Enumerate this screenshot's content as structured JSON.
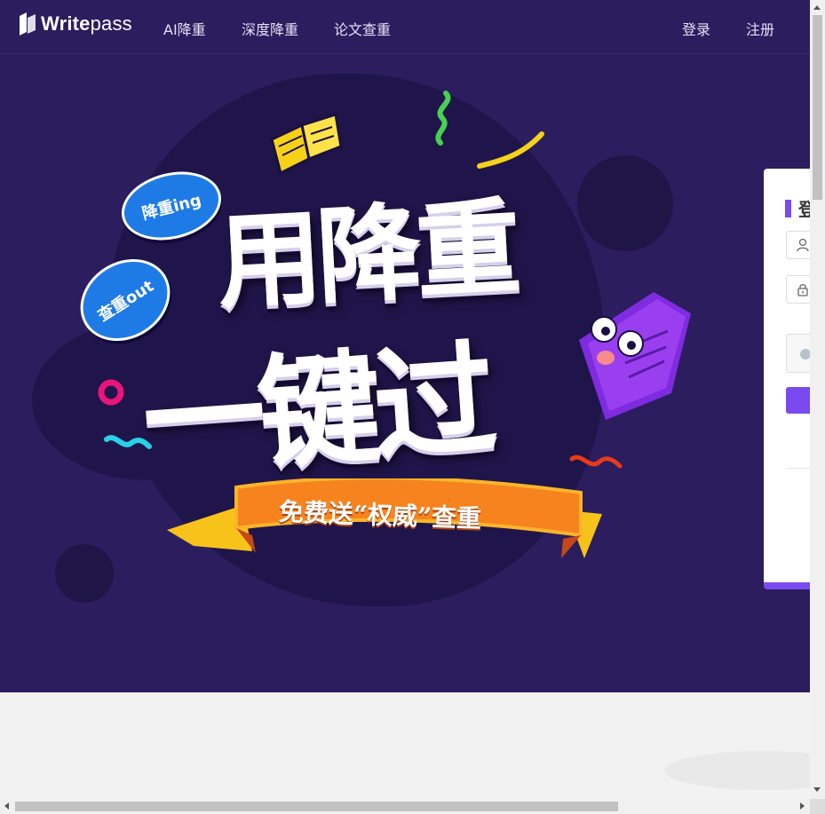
{
  "brand": {
    "name_bold": "Write",
    "name_light": "pass"
  },
  "nav": {
    "items": [
      {
        "label": "AI降重"
      },
      {
        "label": "深度降重"
      },
      {
        "label": "论文查重"
      }
    ],
    "login": "登录",
    "register": "注册"
  },
  "hero": {
    "line1": "用降重",
    "line2": "一键过",
    "bubble1": "降重ing",
    "bubble2": "查重out",
    "ribbon": "免费送“权威”查重"
  },
  "login_card": {
    "title_partial": "登"
  },
  "colors": {
    "nav_bg": "#2b1d5e",
    "accent": "#7a4af0",
    "ribbon": "#f7831f"
  }
}
